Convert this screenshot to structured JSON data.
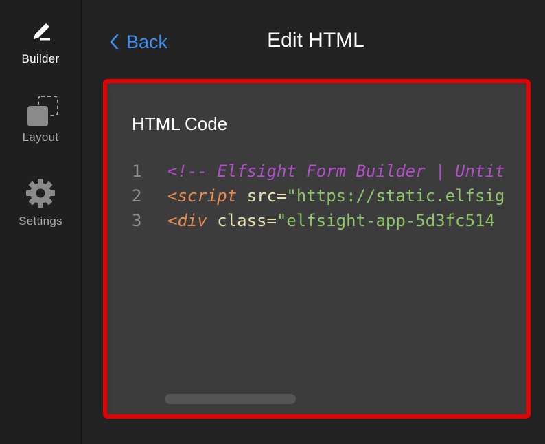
{
  "sidebar": {
    "items": [
      {
        "label": "Builder",
        "icon": "pencil-icon",
        "active": true
      },
      {
        "label": "Layout",
        "icon": "layout-icon",
        "active": false
      },
      {
        "label": "Settings",
        "icon": "gear-icon",
        "active": false
      }
    ]
  },
  "header": {
    "back_label": "Back",
    "title": "Edit HTML"
  },
  "editor": {
    "heading": "HTML Code",
    "lines": [
      {
        "number": "1",
        "comment": "<!-- Elfsight Form Builder | Untit"
      },
      {
        "number": "2",
        "tag": "<script",
        "attr": " src",
        "eq": "=",
        "value": "\"https://static.elfsig"
      },
      {
        "number": "3",
        "tag": "<div",
        "attr": " class",
        "eq": "=",
        "value": "\"elfsight-app-5d3fc514"
      }
    ]
  },
  "colors": {
    "accent": "#3d8ff2",
    "highlight": "#e60000",
    "comment": "#b04fc8",
    "tag": "#e68a50",
    "string": "#8fc46a"
  }
}
